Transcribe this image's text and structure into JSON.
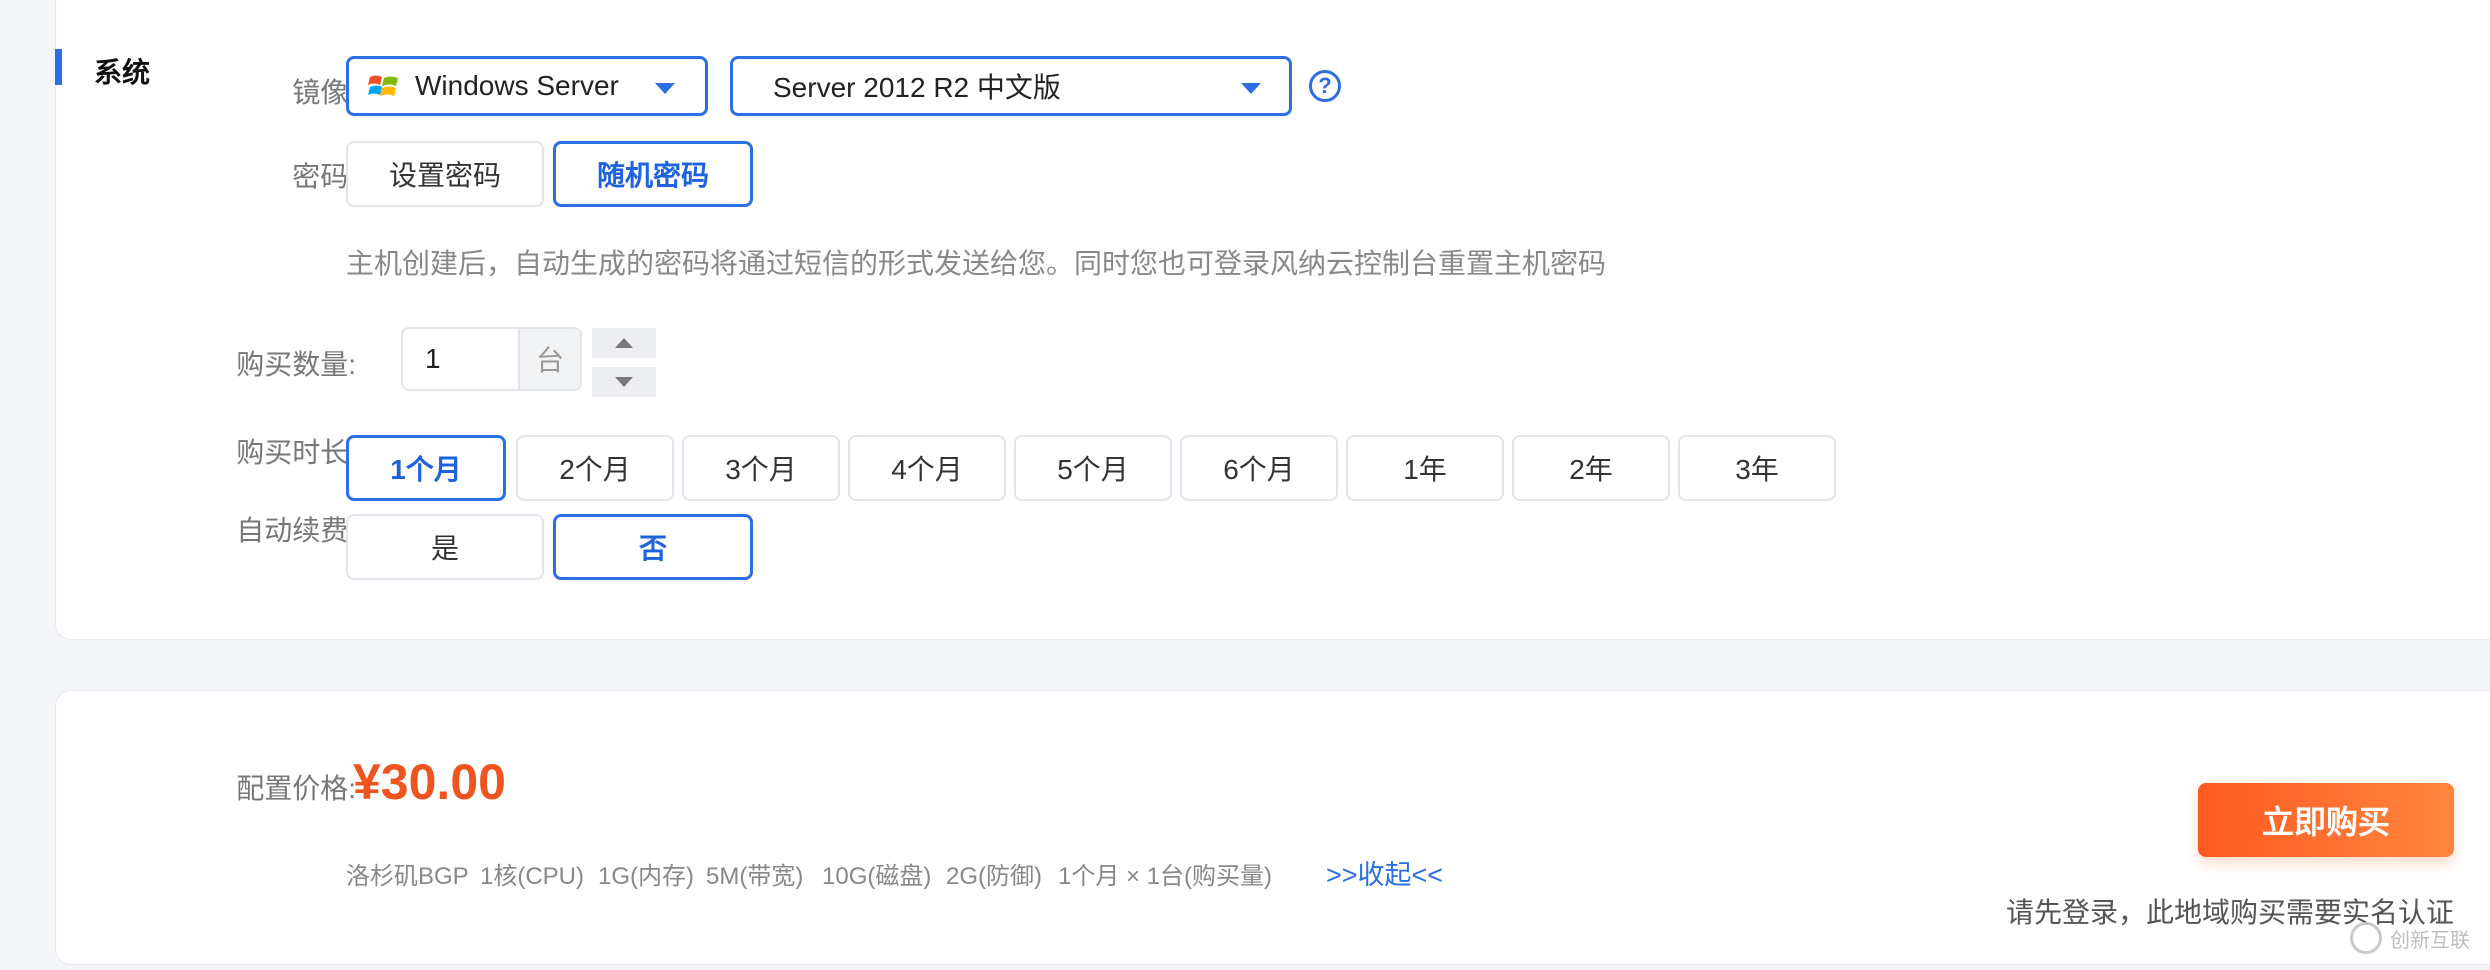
{
  "system": {
    "section_title": "系统",
    "image_label": "镜像:",
    "os_family": "Windows Server",
    "os_version": "Server 2012 R2 中文版",
    "help_glyph": "?",
    "password_label": "密码:",
    "password_options": [
      "设置密码",
      "随机密码"
    ],
    "password_selected": "随机密码",
    "password_hint": "主机创建后，自动生成的密码将通过短信的形式发送给您。同时您也可登录风纳云控制台重置主机密码",
    "quantity_label": "购买数量:",
    "quantity_value": "1",
    "quantity_unit": "台",
    "duration_label": "购买时长:",
    "durations": [
      "1个月",
      "2个月",
      "3个月",
      "4个月",
      "5个月",
      "6个月",
      "1年",
      "2年",
      "3年"
    ],
    "duration_selected": "1个月",
    "auto_renew_label": "自动续费:",
    "auto_renew_options": [
      "是",
      "否"
    ],
    "auto_renew_selected": "否"
  },
  "price": {
    "label": "配置价格:",
    "value": "¥30.00",
    "specs": [
      "洛杉矶BGP",
      "1核(CPU)",
      "1G(内存)",
      "5M(带宽)",
      "10G(磁盘)",
      "2G(防御)",
      "1个月 × 1台(购买量)"
    ],
    "collapse_link": ">>收起<<",
    "buy_button": "立即购买",
    "login_hint": "请先登录，此地域购买需要实名认证"
  },
  "watermark": {
    "text": "创新互联"
  },
  "colors": {
    "primary": "#2b6fe6",
    "price": "#f0541e",
    "buy_start": "#ff5a1f",
    "buy_end": "#ff8640"
  },
  "icons": {
    "os_logo": "windows-logo-icon",
    "help": "help-icon",
    "select_caret": "caret-down-icon"
  }
}
